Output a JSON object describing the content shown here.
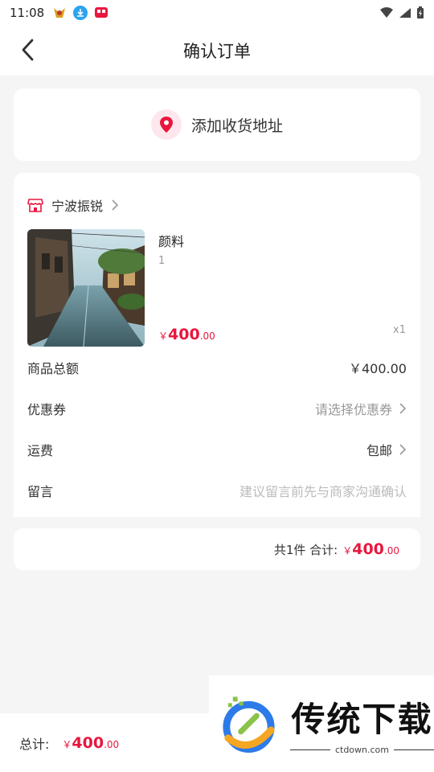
{
  "status": {
    "time": "11:08"
  },
  "header": {
    "title": "确认订单"
  },
  "address": {
    "label": "添加收货地址"
  },
  "shop": {
    "name": "宁波振锐"
  },
  "product": {
    "name": "颜料",
    "spec": "1",
    "price_symbol": "￥",
    "price_int": "400",
    "price_dec": ".00",
    "quantity": "x1"
  },
  "rows": {
    "total_label": "商品总额",
    "total_value": "￥400.00",
    "coupon_label": "优惠券",
    "coupon_value": "请选择优惠券",
    "shipping_label": "运费",
    "shipping_value": "包邮",
    "note_label": "留言",
    "note_placeholder": "建议留言前先与商家沟通确认"
  },
  "summary": {
    "text": "共1件 合计:",
    "price_symbol": "￥",
    "price_int": "400",
    "price_dec": ".00"
  },
  "bottom": {
    "label": "总计:",
    "price_symbol": "￥",
    "price_int": "400",
    "price_dec": ".00"
  },
  "watermark": {
    "title": "传统下载",
    "domain": "ctdown.com"
  },
  "colors": {
    "accent": "#e8173e",
    "background": "#f5f5f5"
  }
}
